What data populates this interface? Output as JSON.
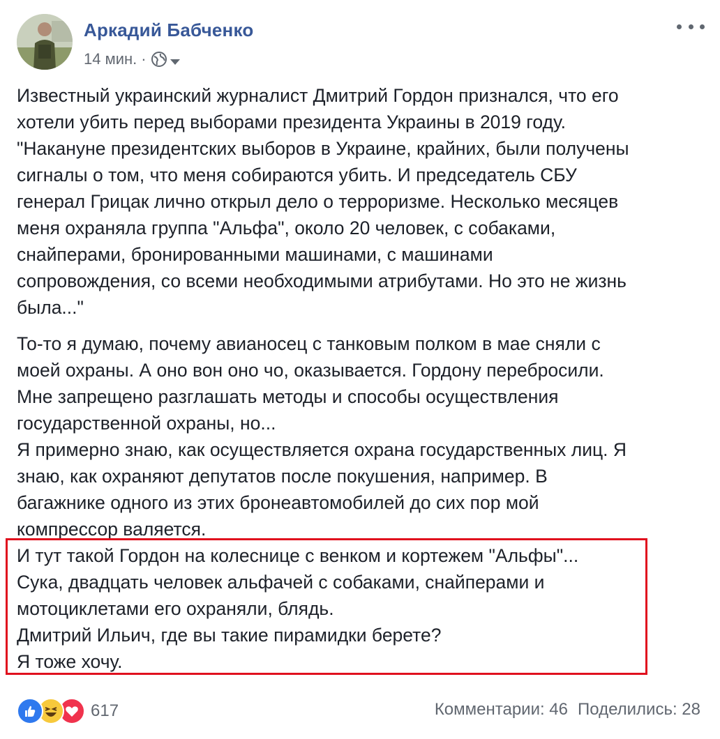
{
  "post": {
    "author": "Аркадий Бабченко",
    "time": "14 мин.",
    "separator": "·",
    "privacy_icon": "globe-icon",
    "menu_icon": "more-horizontal-icon"
  },
  "body": {
    "paragraph1": [
      "Известный украинский журналист Дмитрий Гордон признался, что его",
      "хотели убить перед выборами президента Украины в 2019 году.",
      "\"Накануне президентских выборов в Украине, крайних, были получены",
      "сигналы о том, что меня собираются убить. И председатель СБУ",
      "генерал Грицак лично открыл дело о терроризме. Несколько месяцев",
      "меня охраняла группа \"Альфа\", около 20 человек, с собаками,",
      "снайперами, бронированными машинами, с машинами",
      "сопровождения, со всеми необходимыми атрибутами. Но это не жизнь",
      "была...\""
    ],
    "paragraph2": [
      "То-то я думаю, почему авианосец с танковым полком в мае сняли с",
      "моей охраны. А оно вон оно чо, оказывается. Гордону перебросили.",
      "Мне запрещено разглашать методы и способы осуществления",
      "государственной охраны, но...",
      "Я примерно знаю, как осуществляется охрана государственных лиц. Я",
      "знаю, как охраняют депутатов после покушения, например. В",
      "багажнике одного из этих бронеавтомобилей до сих пор мой",
      "компрессор валяется.",
      "И тут такой Гордон на колеснице с венком и кортежем \"Альфы\"...",
      "Сука, двадцать человек альфачей с собаками, снайперами и",
      "мотоциклетами его охраняли, блядь.",
      "Дмитрий Ильич, где вы такие пирамидки берете?",
      "Я тоже хочу."
    ]
  },
  "footer": {
    "reaction_icons": [
      "like-icon",
      "haha-icon",
      "love-icon"
    ],
    "reactions_count": "617",
    "comments": "Комментарии: 46",
    "shares": "Поделились: 28"
  },
  "colors": {
    "author": "#385898",
    "text": "#1d2129",
    "meta": "#616770",
    "highlight_border": "#e0101e",
    "like": "#2f79ee",
    "haha": "#f7c93c",
    "love": "#f0334d"
  }
}
